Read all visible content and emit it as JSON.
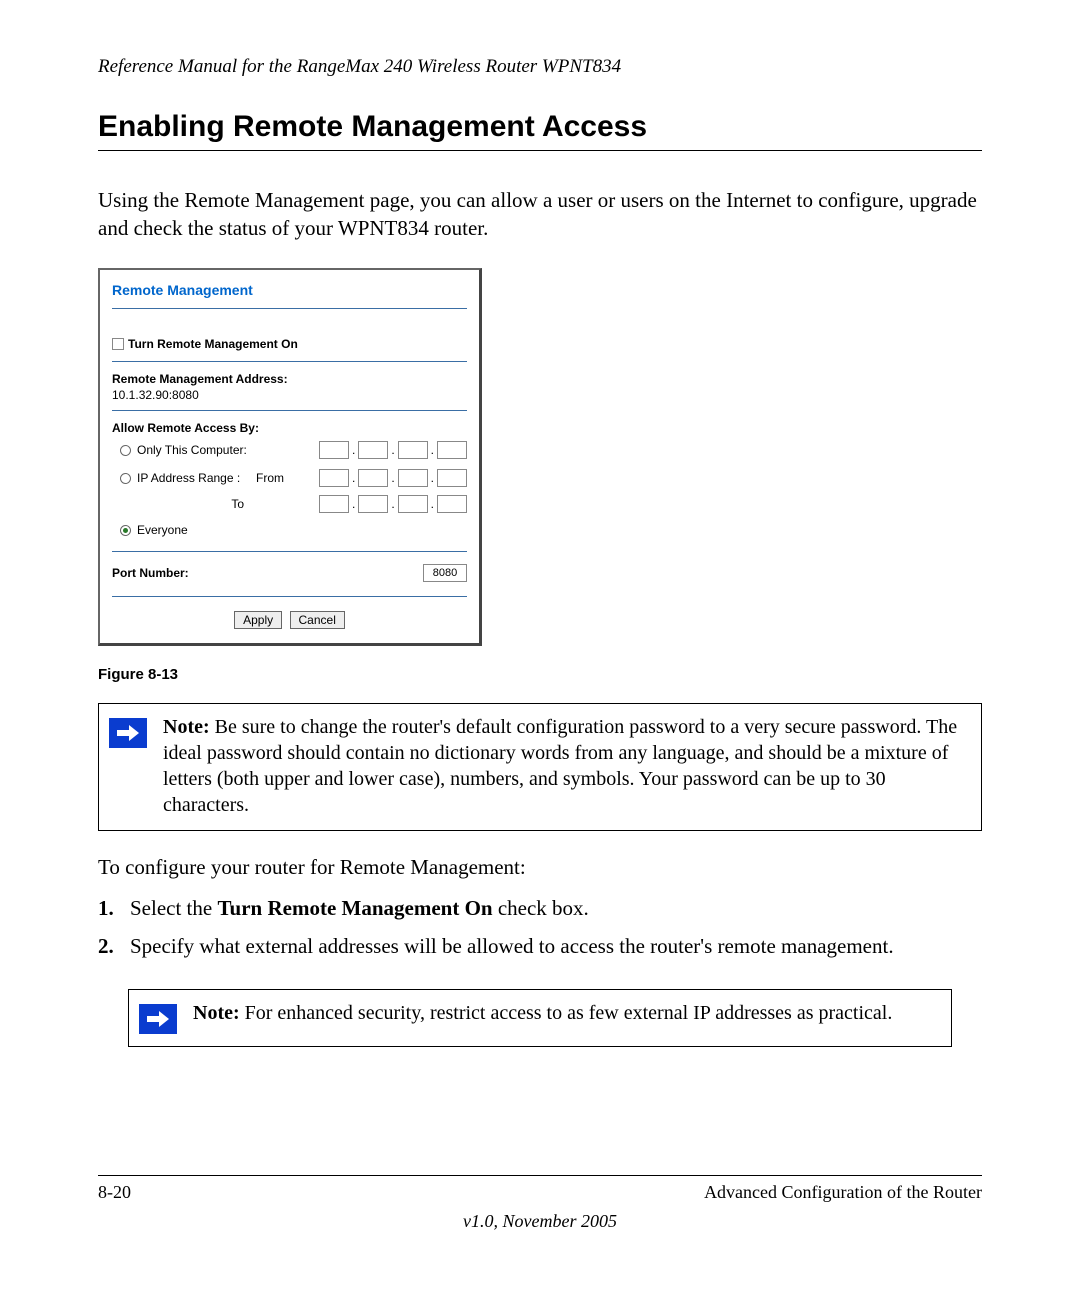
{
  "header": "Reference Manual for the RangeMax 240 Wireless Router WPNT834",
  "section_title": "Enabling Remote Management Access",
  "intro": "Using the Remote Management page, you can allow a user or users on the Internet to configure, upgrade and check the status of your WPNT834 router.",
  "router_ui": {
    "title": "Remote Management",
    "checkbox_label": "Turn Remote Management On",
    "address_label": "Remote Management Address:",
    "address_value": "10.1.32.90:8080",
    "allow_label": "Allow Remote Access By:",
    "radio_only": "Only This Computer:",
    "radio_range": "IP Address Range :",
    "range_from": "From",
    "range_to": "To",
    "radio_everyone": "Everyone",
    "port_label": "Port Number:",
    "port_value": "8080",
    "apply": "Apply",
    "cancel": "Cancel"
  },
  "figure_caption": "Figure 8-13",
  "note1": {
    "lead": "Note:",
    "text": " Be sure to change the router's default configuration password to a very secure password. The ideal password should contain no dictionary words from any language, and should be a mixture of letters (both upper and lower case), numbers, and symbols. Your password can be up to 30 characters."
  },
  "config_intro": "To configure your router for Remote Management:",
  "steps": [
    {
      "num": "1.",
      "pre": "Select the ",
      "bold": "Turn Remote Management On",
      "post": " check box."
    },
    {
      "num": "2.",
      "pre": "Specify what external addresses will be allowed to access the router's remote management.",
      "bold": "",
      "post": ""
    }
  ],
  "note2": {
    "lead": "Note:",
    "text": " For enhanced security, restrict access to as few external IP addresses as practical."
  },
  "footer": {
    "page": "8-20",
    "chapter": "Advanced Configuration of the Router",
    "version": "v1.0, November 2005"
  }
}
